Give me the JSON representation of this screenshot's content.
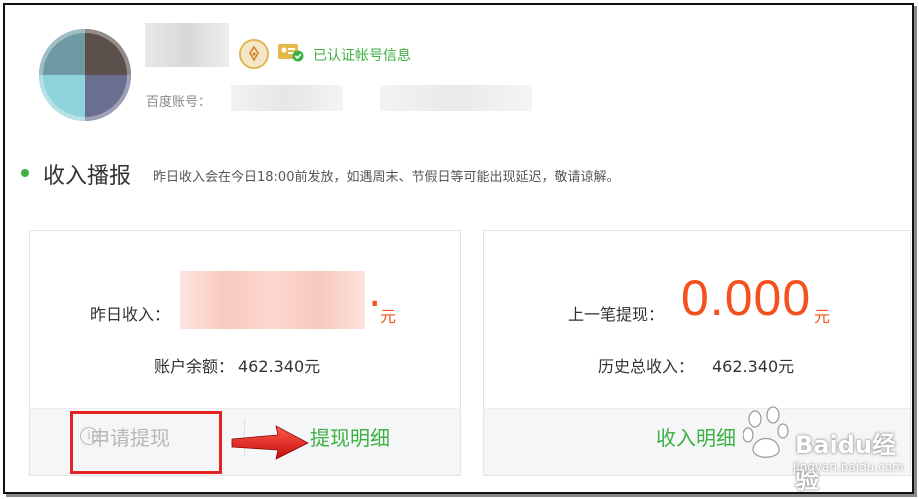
{
  "profile": {
    "verified_text": "已认证帐号信息",
    "account_label": "百度账号：",
    "icons": [
      "avatar",
      "pen-medal-icon",
      "id-card-verified-icon"
    ]
  },
  "section": {
    "title": "收入播报",
    "note": "昨日收入会在今日18:00前发放，如遇周末、节假日等可能出现延迟，敬请谅解。"
  },
  "income_card": {
    "yesterday_label": "昨日收入：",
    "yesterday_tail": ".",
    "yuan": "元",
    "balance_label": "账户余额：",
    "balance_value": "462.340元",
    "withdraw_button": "申请提现",
    "withdraw_detail_link": "提现明细"
  },
  "withdraw_card": {
    "last_withdraw_label": "上一笔提现：",
    "last_withdraw_value": "0.000",
    "yuan": "元",
    "total_income_label": "历史总收入：",
    "total_income_value": "462.340元",
    "income_detail_link": "收入明细"
  },
  "watermark": {
    "brand": "Baidu经验",
    "site": "jingyan.baidu.com"
  },
  "colors": {
    "accent_green": "#3cb043",
    "amount_orange": "#f4511e",
    "highlight_red": "#e52222"
  }
}
